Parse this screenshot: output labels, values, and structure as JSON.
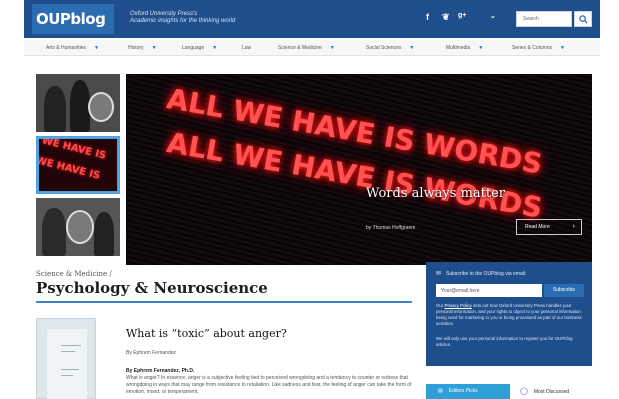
{
  "header": {
    "logo_text": "OUPblog",
    "tagline_line1": "Oxford University Press's",
    "tagline_line2": "Academic insights for the thinking world",
    "social": {
      "facebook": "f",
      "twitter": "❦",
      "googleplus": "g+",
      "more": "⌄"
    },
    "search_placeholder": "Search",
    "search_icon": "magnifier-icon"
  },
  "nav": {
    "items": [
      "Arts & Humanities",
      "History",
      "Language",
      "Law",
      "Science & Medicine",
      "Social Sciences",
      "Multimedia",
      "Series & Columns"
    ]
  },
  "hero": {
    "neon_line1": "ALL WE HAVE IS WORDS",
    "neon_line2": "ALL WE HAVE IS WORDS",
    "thumb_neon": "WE HAVE IS",
    "caption": "Words always matter",
    "byline": "by Thomas Hoffgraem",
    "read_more": "Read More",
    "read_more_arrow": "›"
  },
  "section": {
    "kicker": "Science & Medicine /",
    "title": "Psychology & Neuroscience"
  },
  "article": {
    "title": "What is “toxic” about anger?",
    "byline": "By Ephrem Fernandez",
    "author": "By Ephrem Fernandez, Ph.D.",
    "excerpt": "What is anger? In essence, anger is a subjective feeling tied to perceived wrongdoing and a tendency to counter or redress that wrongdoing in ways that may range from resistance to retaliation. Like sadness and fear, the feeling of anger can take the form of emotion, mood, or temperament."
  },
  "subscribe": {
    "heading": "Subscribe to the OUPblog via email:",
    "email_placeholder": "Your@email.here",
    "button": "Subscribe",
    "privacy_link": "Privacy Policy",
    "privacy_pre": "Our ",
    "privacy_post": " sets out how Oxford University Press handles your personal information, and your rights to object to your personal information being used for marketing to you or being processed as part of our business activities.",
    "privacy2": "We will only use your personal information to register you for OUPblog articles."
  },
  "tabs": {
    "popular": "Editors Picks",
    "discussed": "Most Discussed"
  },
  "colors": {
    "brand_blue": "#1f4e8c",
    "accent_blue": "#2f9fd8",
    "neon_red": "#ff5252"
  }
}
